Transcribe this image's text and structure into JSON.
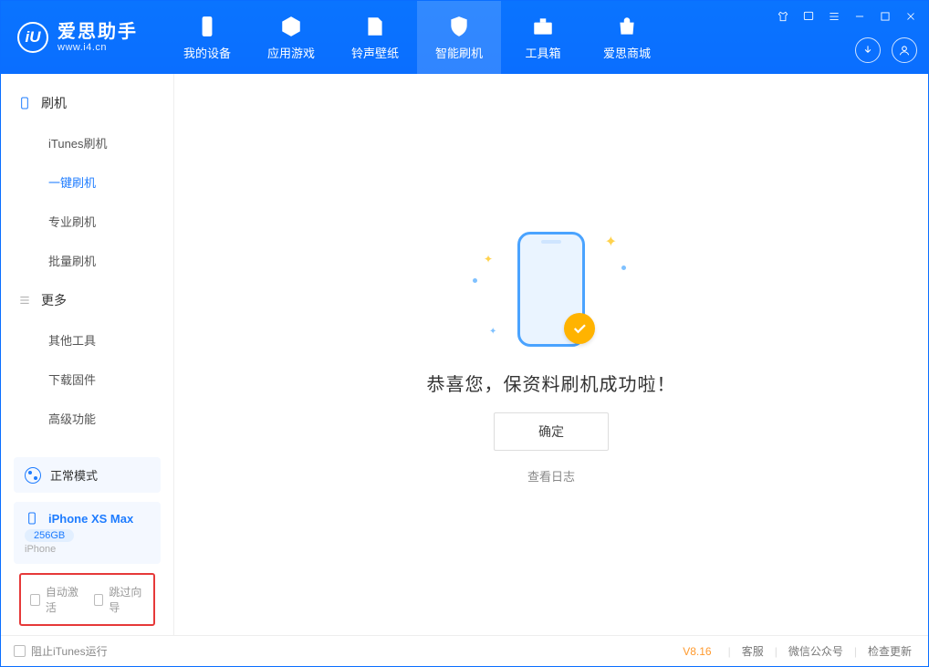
{
  "app": {
    "name_cn": "爱思助手",
    "url": "www.i4.cn",
    "logo_letter": "iU"
  },
  "tabs": [
    {
      "label": "我的设备"
    },
    {
      "label": "应用游戏"
    },
    {
      "label": "铃声壁纸"
    },
    {
      "label": "智能刷机"
    },
    {
      "label": "工具箱"
    },
    {
      "label": "爱思商城"
    }
  ],
  "sidebar": {
    "group_flash": "刷机",
    "items_flash": [
      {
        "label": "iTunes刷机"
      },
      {
        "label": "一键刷机"
      },
      {
        "label": "专业刷机"
      },
      {
        "label": "批量刷机"
      }
    ],
    "group_more": "更多",
    "items_more": [
      {
        "label": "其他工具"
      },
      {
        "label": "下载固件"
      },
      {
        "label": "高级功能"
      }
    ]
  },
  "mode_panel": {
    "label": "正常模式"
  },
  "device_panel": {
    "name": "iPhone XS Max",
    "capacity": "256GB",
    "type": "iPhone"
  },
  "option_checks": {
    "auto_activate": "自动激活",
    "skip_guide": "跳过向导"
  },
  "main": {
    "success": "恭喜您，保资料刷机成功啦！",
    "ok": "确定",
    "view_log": "查看日志"
  },
  "statusbar": {
    "block_itunes": "阻止iTunes运行",
    "version": "V8.16",
    "links": [
      "客服",
      "微信公众号",
      "检查更新"
    ]
  }
}
